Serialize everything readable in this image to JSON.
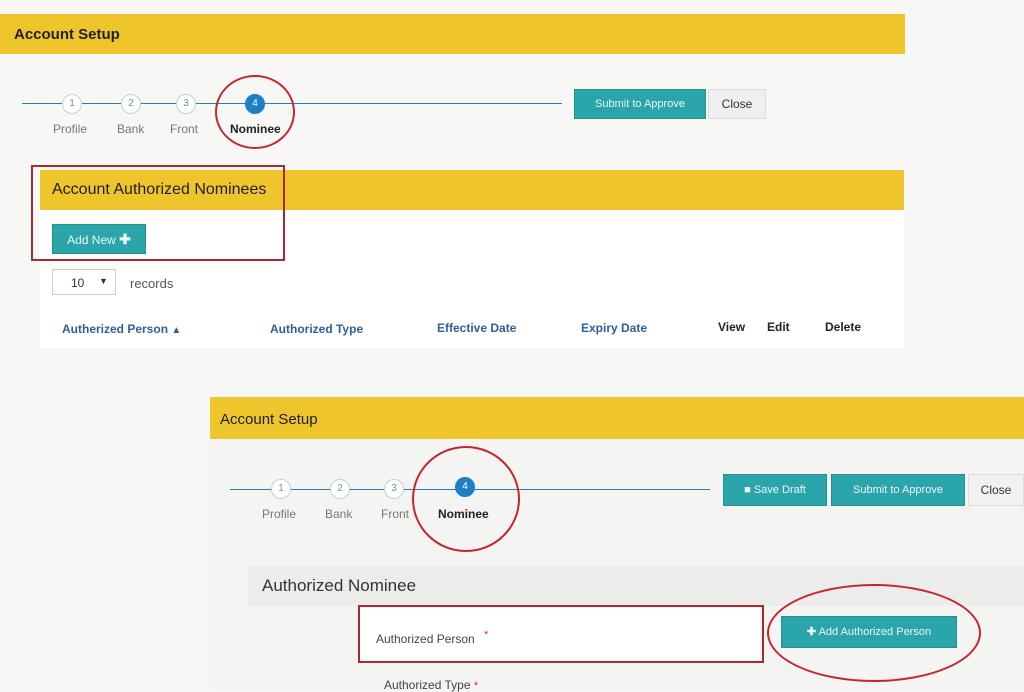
{
  "top": {
    "banner_title": "Account Setup",
    "steps": [
      {
        "num": "1",
        "label": "Profile"
      },
      {
        "num": "2",
        "label": "Bank"
      },
      {
        "num": "3",
        "label": "Front"
      },
      {
        "num": "4",
        "label": "Nominee"
      }
    ],
    "submit_label": "Submit to Approve",
    "close_label": "Close",
    "section_title": "Account Authorized Nominees",
    "add_new_label": "Add New",
    "page_size_value": "10",
    "records_label": "records",
    "columns": [
      "Autherized Person",
      "Authorized Type",
      "Effective Date",
      "Expiry Date",
      "View",
      "Edit",
      "Delete"
    ]
  },
  "bottom": {
    "banner_title": "Account Setup",
    "steps": [
      {
        "num": "1",
        "label": "Profile"
      },
      {
        "num": "2",
        "label": "Bank"
      },
      {
        "num": "3",
        "label": "Front"
      },
      {
        "num": "4",
        "label": "Nominee"
      }
    ],
    "save_draft_label": "Save Draft",
    "submit_label": "Submit to Approve",
    "close_label": "Close",
    "panel_title": "Authorized Nominee",
    "authorized_person_label": "Authorized Person",
    "required_mark": "*",
    "add_person_label": "Add Authorized Person",
    "authorized_type_label": "Authorized Type"
  },
  "colors": {
    "banner": "#efc52c",
    "teal": "#2aa5a9",
    "step_active": "#1f7fc4",
    "highlight_red": "#c4262e"
  }
}
